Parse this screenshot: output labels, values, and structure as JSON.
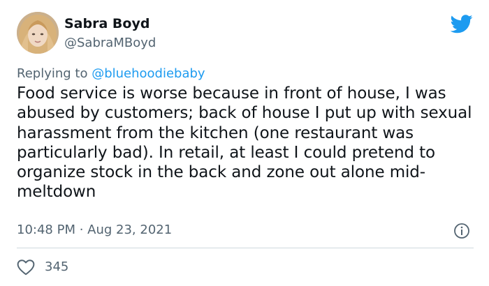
{
  "author": {
    "display_name": "Sabra Boyd",
    "handle": "@SabraMBoyd"
  },
  "reply": {
    "prefix": "Replying to ",
    "mention": "@bluehoodiebaby"
  },
  "tweet": {
    "text": "Food service is worse because in front of house, I was abused by customers; back of house I put up with sexual harassment from the kitchen (one restaurant was particularly bad). In retail, at least I could pretend to organize stock in the back and zone out alone mid-meltdown",
    "time": "10:48 PM",
    "separator": " · ",
    "date": "Aug 23, 2021"
  },
  "actions": {
    "like_count": "345"
  },
  "icons": {
    "brand": "twitter-bird-icon",
    "info": "info-icon",
    "like": "heart-icon"
  },
  "colors": {
    "brand_blue": "#1d9bf0",
    "secondary_text": "#536471",
    "primary_text": "#0f1419",
    "divider": "#cfd9de"
  }
}
